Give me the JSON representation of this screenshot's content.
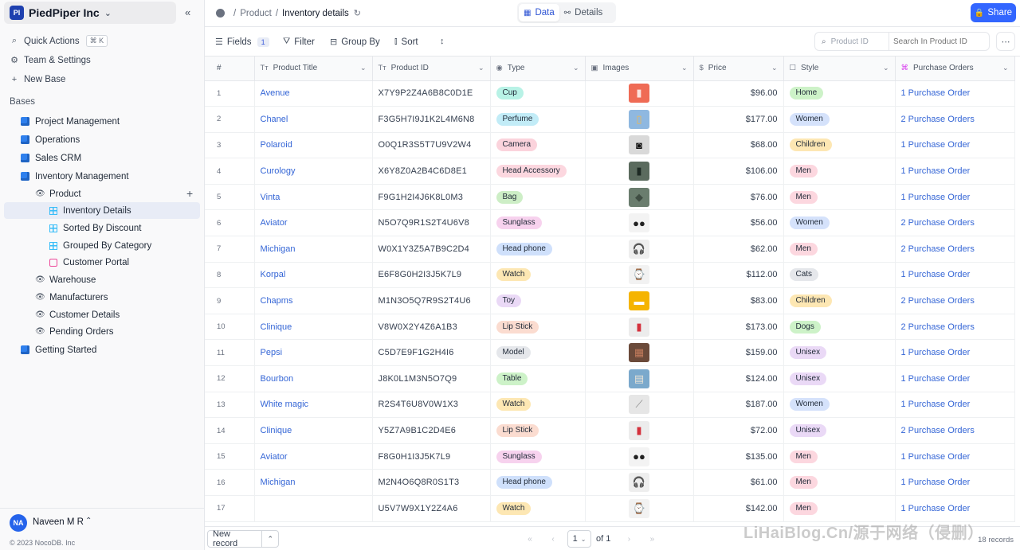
{
  "workspace": {
    "name": "PiedPiper Inc",
    "initials": "PI"
  },
  "sidebar": {
    "top_items": [
      {
        "label": "Quick Actions",
        "shortcut": "⌘ K"
      },
      {
        "label": "Team & Settings"
      },
      {
        "label": "New Base"
      }
    ],
    "bases_label": "Bases",
    "bases": {
      "project_management": "Project Management",
      "operations": "Operations",
      "sales_crm": "Sales CRM",
      "inventory_management": "Inventory Management",
      "product": "Product",
      "views": [
        "Inventory Details",
        "Sorted By Discount",
        "Grouped By Category",
        "Customer Portal"
      ],
      "tables": [
        "Warehouse",
        "Manufacturers",
        "Customer Details",
        "Pending Orders"
      ],
      "getting_started": "Getting Started"
    },
    "user": {
      "name": "Naveen M R",
      "initials": "NA"
    },
    "copyright": "© 2023 NocoDB. Inc"
  },
  "topbar": {
    "breadcrumb": [
      "Product",
      "Inventory details"
    ],
    "tabs": [
      "Data",
      "Details"
    ],
    "share_label": "Share"
  },
  "toolbar": {
    "fields_label": "Fields",
    "fields_count": "1",
    "filter_label": "Filter",
    "groupby_label": "Group By",
    "sort_label": "Sort",
    "search_field": "Product ID",
    "search_placeholder": "Search In Product ID"
  },
  "grid": {
    "columns": [
      "#",
      "Product Title",
      "Product ID",
      "Type",
      "Images",
      "Price",
      "Style",
      "Purchase Orders"
    ],
    "rows": [
      {
        "n": "1",
        "title": "Avenue",
        "pid": "X7Y9P2Z4A6B8C0D1E",
        "type": "Cup",
        "price": "$96.00",
        "style": "Home",
        "po": "1 Purchase Order",
        "img": "cup"
      },
      {
        "n": "2",
        "title": "Chanel",
        "pid": "F3G5H7I9J1K2L4M6N8",
        "type": "Perfume",
        "price": "$177.00",
        "style": "Women",
        "po": "2 Purchase Orders",
        "img": "perfume"
      },
      {
        "n": "3",
        "title": "Polaroid",
        "pid": "O0Q1R3S5T7U9V2W4",
        "type": "Camera",
        "price": "$68.00",
        "style": "Children",
        "po": "1 Purchase Order",
        "img": "camera"
      },
      {
        "n": "4",
        "title": "Curology",
        "pid": "X6Y8Z0A2B4C6D8E1",
        "type": "Head Accessory",
        "price": "$106.00",
        "style": "Men",
        "po": "1 Purchase Order",
        "img": "bottles"
      },
      {
        "n": "5",
        "title": "Vinta",
        "pid": "F9G1H2I4J6K8L0M3",
        "type": "Bag",
        "price": "$76.00",
        "style": "Men",
        "po": "1 Purchase Order",
        "img": "bag"
      },
      {
        "n": "6",
        "title": "Aviator",
        "pid": "N5O7Q9R1S2T4U6V8",
        "type": "Sunglass",
        "price": "$56.00",
        "style": "Women",
        "po": "2 Purchase Orders",
        "img": "sunglass"
      },
      {
        "n": "7",
        "title": "Michigan",
        "pid": "W0X1Y3Z5A7B9C2D4",
        "type": "Head phone",
        "price": "$62.00",
        "style": "Men",
        "po": "2 Purchase Orders",
        "img": "headphone"
      },
      {
        "n": "8",
        "title": "Korpal",
        "pid": "E6F8G0H2I3J5K7L9",
        "type": "Watch",
        "price": "$112.00",
        "style": "Cats",
        "po": "1 Purchase Order",
        "img": "watch"
      },
      {
        "n": "9",
        "title": "Chapms",
        "pid": "M1N3O5Q7R9S2T4U6",
        "type": "Toy",
        "price": "$83.00",
        "style": "Children",
        "po": "2 Purchase Orders",
        "img": "toy"
      },
      {
        "n": "10",
        "title": "Clinique",
        "pid": "V8W0X2Y4Z6A1B3",
        "type": "Lip Stick",
        "price": "$173.00",
        "style": "Dogs",
        "po": "2 Purchase Orders",
        "img": "lipstick"
      },
      {
        "n": "11",
        "title": "Pepsi",
        "pid": "C5D7E9F1G2H4I6",
        "type": "Model",
        "price": "$159.00",
        "style": "Unisex",
        "po": "1 Purchase Order",
        "img": "model"
      },
      {
        "n": "12",
        "title": "Bourbon",
        "pid": "J8K0L1M3N5O7Q9",
        "type": "Table",
        "price": "$124.00",
        "style": "Unisex",
        "po": "1 Purchase Order",
        "img": "table"
      },
      {
        "n": "13",
        "title": "White magic",
        "pid": "R2S4T6U8V0W1X3",
        "type": "Watch",
        "price": "$187.00",
        "style": "Women",
        "po": "1 Purchase Order",
        "img": "watch2"
      },
      {
        "n": "14",
        "title": "Clinique",
        "pid": "Y5Z7A9B1C2D4E6",
        "type": "Lip Stick",
        "price": "$72.00",
        "style": "Unisex",
        "po": "2 Purchase Orders",
        "img": "lipstick"
      },
      {
        "n": "15",
        "title": "Aviator",
        "pid": "F8G0H1I3J5K7L9",
        "type": "Sunglass",
        "price": "$135.00",
        "style": "Men",
        "po": "1 Purchase Order",
        "img": "sunglass"
      },
      {
        "n": "16",
        "title": "Michigan",
        "pid": "M2N4O6Q8R0S1T3",
        "type": "Head phone",
        "price": "$61.00",
        "style": "Men",
        "po": "1 Purchase Order",
        "img": "headphone"
      },
      {
        "n": "17",
        "title": "",
        "pid": "U5V7W9X1Y2Z4A6",
        "type": "Watch",
        "price": "$142.00",
        "style": "Men",
        "po": "1 Purchase Order",
        "img": "watch"
      }
    ]
  },
  "type_colors": {
    "Cup": "#b8f2e6",
    "Perfume": "#c2ecf7",
    "Camera": "#fbd3dc",
    "Head Accessory": "#fcd7df",
    "Bag": "#cdeec6",
    "Sunglass": "#f7d2ee",
    "Head phone": "#cfe0fb",
    "Watch": "#fde7b3",
    "Toy": "#ead9f6",
    "Lip Stick": "#fbdcd0",
    "Model": "#e5e7eb",
    "Table": "#cdf2c8"
  },
  "style_colors": {
    "Home": "#cdf2c8",
    "Women": "#d5e2fb",
    "Children": "#fde7b3",
    "Men": "#fcd7df",
    "Cats": "#e5e7eb",
    "Dogs": "#cdf2c8",
    "Unisex": "#ead9f6"
  },
  "footer": {
    "new_record_label": "New record",
    "page": "1",
    "of_label": "of 1",
    "records_label": "18 records",
    "watermark": "LiHaiBlog.Cn/源于网络（侵删）"
  }
}
